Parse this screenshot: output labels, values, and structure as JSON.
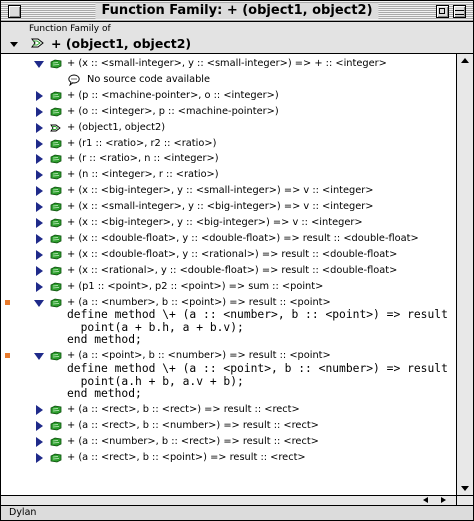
{
  "window": {
    "title": "Function Family: + (object1, object2)"
  },
  "header": {
    "caption": "Function Family of",
    "title": "+ (object1, object2)"
  },
  "rows": [
    {
      "expander": "expanded",
      "icon": "method-icon",
      "text": "+ (x :: <small-integer>, y :: <small-integer>) => + :: <integer>"
    },
    {
      "expander": "none",
      "icon": "note-icon",
      "text": "No source code available"
    },
    {
      "expander": "collapsed",
      "icon": "method-icon",
      "text": "+ (p :: <machine-pointer>, o :: <integer>)"
    },
    {
      "expander": "collapsed",
      "icon": "method-icon",
      "text": "+ (o :: <integer>, p :: <machine-pointer>)"
    },
    {
      "expander": "collapsed",
      "icon": "generic-icon",
      "text": "+ (object1, object2)"
    },
    {
      "expander": "collapsed",
      "icon": "method-icon",
      "text": "+ (r1 :: <ratio>, r2 :: <ratio>)"
    },
    {
      "expander": "collapsed",
      "icon": "method-icon",
      "text": "+ (r :: <ratio>, n :: <integer>)"
    },
    {
      "expander": "collapsed",
      "icon": "method-icon",
      "text": "+ (n :: <integer>, r :: <ratio>)"
    },
    {
      "expander": "collapsed",
      "icon": "method-icon",
      "text": "+ (x :: <big-integer>, y :: <small-integer>) => v :: <integer>"
    },
    {
      "expander": "collapsed",
      "icon": "method-icon",
      "text": "+ (x :: <small-integer>, y :: <big-integer>) => v :: <integer>"
    },
    {
      "expander": "collapsed",
      "icon": "method-icon",
      "text": "+ (x :: <big-integer>, y :: <big-integer>) => v :: <integer>"
    },
    {
      "expander": "collapsed",
      "icon": "method-icon",
      "text": "+ (x :: <double-float>, y :: <double-float>) => result :: <double-float>"
    },
    {
      "expander": "collapsed",
      "icon": "method-icon",
      "text": "+ (x :: <double-float>, y :: <rational>) => result :: <double-float>"
    },
    {
      "expander": "collapsed",
      "icon": "method-icon",
      "text": "+ (x :: <rational>, y :: <double-float>) => result :: <double-float>"
    },
    {
      "expander": "collapsed",
      "icon": "method-icon",
      "text": "+ (p1 :: <point>, p2 :: <point>) => sum :: <point>"
    },
    {
      "expander": "expanded",
      "icon": "method-icon",
      "marker": true,
      "text": "+ (a :: <number>, b :: <point>) => result :: <point>"
    },
    {
      "expander": "expanded",
      "icon": "method-icon",
      "marker": true,
      "text": "+ (a :: <point>, b :: <number>) => result :: <point>"
    },
    {
      "expander": "collapsed",
      "icon": "method-icon",
      "text": "+ (a :: <rect>, b :: <rect>) => result :: <rect>"
    },
    {
      "expander": "collapsed",
      "icon": "method-icon",
      "text": "+ (a :: <rect>, b :: <number>) => result :: <rect>"
    },
    {
      "expander": "collapsed",
      "icon": "method-icon",
      "text": "+ (a :: <number>, b :: <rect>) => result :: <rect>"
    },
    {
      "expander": "collapsed",
      "icon": "method-icon",
      "text": "+ (a :: <rect>, b :: <point>) => result :: <rect>"
    }
  ],
  "code_blocks": [
    {
      "line1": "define method \\+ (a :: <number>, b :: <point>) => result :: <point>",
      "line2": "  point(a + b.h, a + b.v);",
      "line3": "end method;"
    },
    {
      "line1": "define method \\+ (a :: <point>, b :: <number>) => result :: <point>",
      "line2": "  point(a.h + b, a.v + b);",
      "line3": "end method;"
    }
  ],
  "status": {
    "language": "Dylan"
  },
  "colors": {
    "expander": "#1f2a8a",
    "method_icon": "#2e9e2e",
    "breakpoint_marker": "#e87a2c"
  }
}
